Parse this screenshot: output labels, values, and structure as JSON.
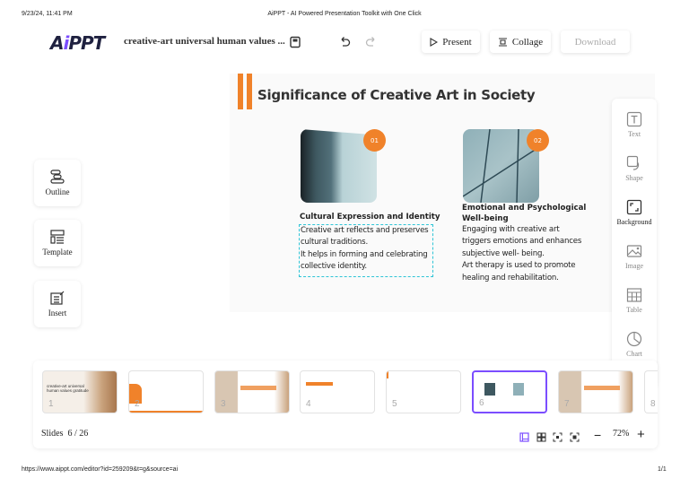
{
  "browser": {
    "datetime": "9/23/24, 11:41 PM",
    "title": "AiPPT - AI Powered Presentation Toolkit with One Click",
    "url": "https://www.aippt.com/editor?id=259209&t=g&source=ai",
    "page": "1/1"
  },
  "header": {
    "logo": "AiPPT",
    "doc_title": "creative-art universal human values ...",
    "present": "Present",
    "collage": "Collage",
    "download": "Download"
  },
  "left_panel": [
    {
      "label": "Outline",
      "icon": "outline-icon"
    },
    {
      "label": "Template",
      "icon": "template-icon"
    },
    {
      "label": "Insert",
      "icon": "insert-icon"
    }
  ],
  "right_tools": [
    {
      "label": "Text"
    },
    {
      "label": "Shape"
    },
    {
      "label": "Background"
    },
    {
      "label": "Image"
    },
    {
      "label": "Table"
    },
    {
      "label": "Chart"
    }
  ],
  "slide": {
    "title": "Significance of Creative Art in Society",
    "items": [
      {
        "badge": "01",
        "heading": "Cultural Expression and Identity",
        "lines": [
          "Creative art reflects and preserves",
          "cultural traditions.",
          "It helps in forming and celebrating",
          "collective identity."
        ]
      },
      {
        "badge": "02",
        "heading1": "Emotional and Psychological",
        "heading2": "Well-being",
        "lines": [
          "Engaging with creative art",
          "triggers emotions and enhances",
          "subjective well- being.",
          "Art therapy is used to promote",
          "healing and rehabilitation."
        ]
      }
    ]
  },
  "filmstrip": {
    "thumbs": [
      {
        "num": "1",
        "text": "creative-art universal human values gratitude"
      },
      {
        "num": "2"
      },
      {
        "num": "3"
      },
      {
        "num": "4"
      },
      {
        "num": "5"
      },
      {
        "num": "6"
      },
      {
        "num": "7"
      },
      {
        "num": "8"
      }
    ],
    "selected": 6
  },
  "footer": {
    "slides_label": "Slides",
    "slides_count": "6 / 26",
    "zoom": "72%",
    "minus": "−",
    "plus": "+"
  },
  "colors": {
    "accent": "#f0822a",
    "selection": "#7b4dff",
    "text_box": "#2ec4d6"
  }
}
